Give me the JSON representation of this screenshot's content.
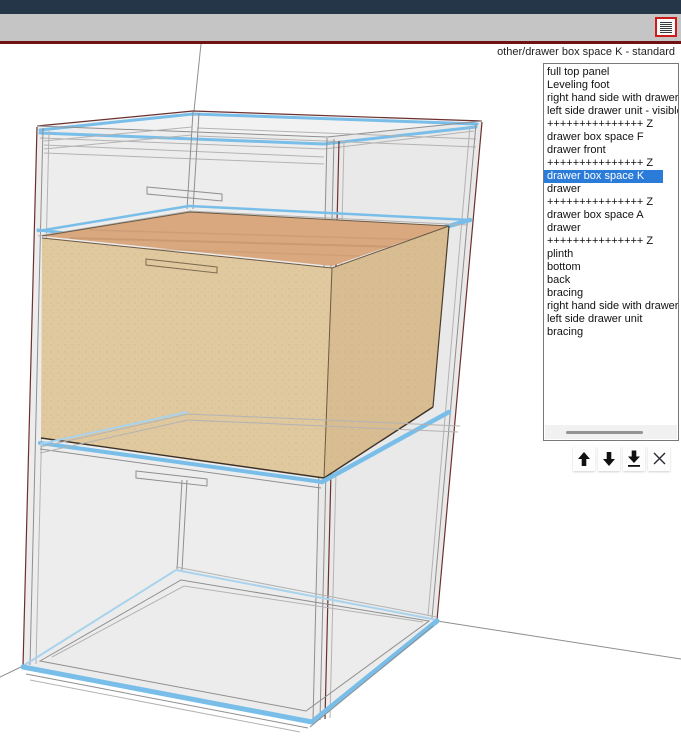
{
  "header": {
    "title": "other/drawer box space K - standard"
  },
  "toolbar": {
    "menu_icon": "hamburger-icon"
  },
  "component_list": {
    "items": [
      "full top panel",
      "Leveling foot",
      "right hand side with drawer -",
      "left side drawer unit - visible",
      "+++++++++++++++ Z",
      "drawer box space F",
      "drawer front",
      "+++++++++++++++ Z",
      "drawer box space K",
      "drawer",
      "+++++++++++++++ Z",
      "drawer box space A",
      "drawer",
      "+++++++++++++++ Z",
      "plinth",
      "bottom",
      "back",
      "bracing",
      "right hand side with drawer",
      "left side drawer unit",
      "bracing"
    ],
    "selected_index": 8,
    "selected_item": "drawer box space K"
  },
  "list_actions": [
    {
      "name": "move-up",
      "icon": "arrow-up-icon"
    },
    {
      "name": "move-down",
      "icon": "arrow-down-icon"
    },
    {
      "name": "move-to-bottom",
      "icon": "arrow-down-underline-icon"
    },
    {
      "name": "delete",
      "icon": "x-icon"
    }
  ],
  "scene": {
    "highlighted_component": "drawer box space K"
  },
  "colors": {
    "titlebar_navy": "#263649",
    "toolbar_gray": "#c5c5c5",
    "accent_red": "#6e1212",
    "selection_blue": "#2b7cd9",
    "highlight_blue": "#79bee9",
    "edge_maroon": "#6d3030",
    "wood_top": "#d9a87f",
    "wood_front": "#e0c89f",
    "wood_side": "#d8bd92"
  }
}
